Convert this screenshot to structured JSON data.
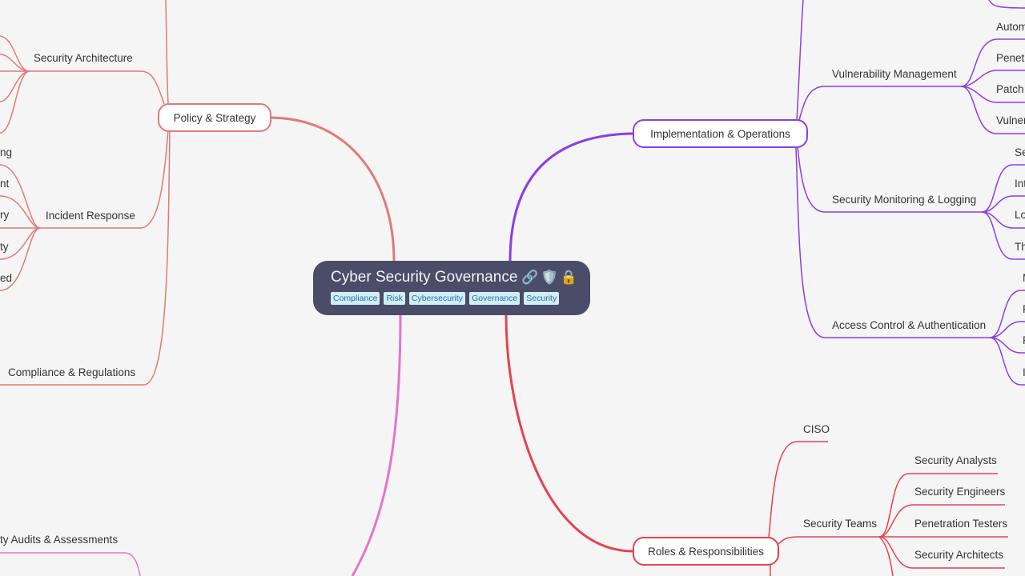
{
  "colors": {
    "background": "#f5f5f5",
    "root_fill": "#4a4c68",
    "policy": "#e07a78",
    "implementation": "#8a3ee8",
    "roles": "#e5424f",
    "audits": "#e573cf",
    "tag_fill": "#cfeef8",
    "tag_text": "#2f6f9a"
  },
  "root": {
    "title": "Cyber Security Governance",
    "icons": [
      "link-icon",
      "shield-icon",
      "lock-icon"
    ],
    "icon_glyphs": [
      "🔗",
      "🛡️",
      "🔒"
    ],
    "tags": [
      "Compliance",
      "Risk",
      "Cybersecurity",
      "Governance",
      "Security"
    ]
  },
  "branches": {
    "policy": {
      "label": "Policy & Strategy",
      "children": [
        {
          "label": "Security Architecture",
          "children_partial": []
        },
        {
          "label": "Incident Response",
          "children_partial": [
            "ng",
            "nt",
            "ry",
            "ty",
            "ed"
          ]
        },
        {
          "label": "Compliance & Regulations"
        }
      ]
    },
    "implementation": {
      "label": "Implementation & Operations",
      "children": [
        {
          "label": "Vulnerability Management",
          "children_partial": [
            "Autom",
            "Penetr",
            "Patch",
            "Vulner"
          ]
        },
        {
          "label": "Security Monitoring & Logging",
          "children_partial": [
            "Se",
            "Int",
            "Lo",
            "Th"
          ]
        },
        {
          "label": "Access Control & Authentication",
          "children_partial": [
            "M",
            "P",
            "R",
            "I"
          ]
        }
      ]
    },
    "roles": {
      "label": "Roles & Responsibilities",
      "children": [
        {
          "label": "CISO"
        },
        {
          "label": "Security Teams",
          "children": [
            "Security Analysts",
            "Security Engineers",
            "Penetration Testers",
            "Security Architects"
          ]
        }
      ]
    },
    "audits": {
      "label_partial": "ty Audits & Assessments"
    }
  }
}
